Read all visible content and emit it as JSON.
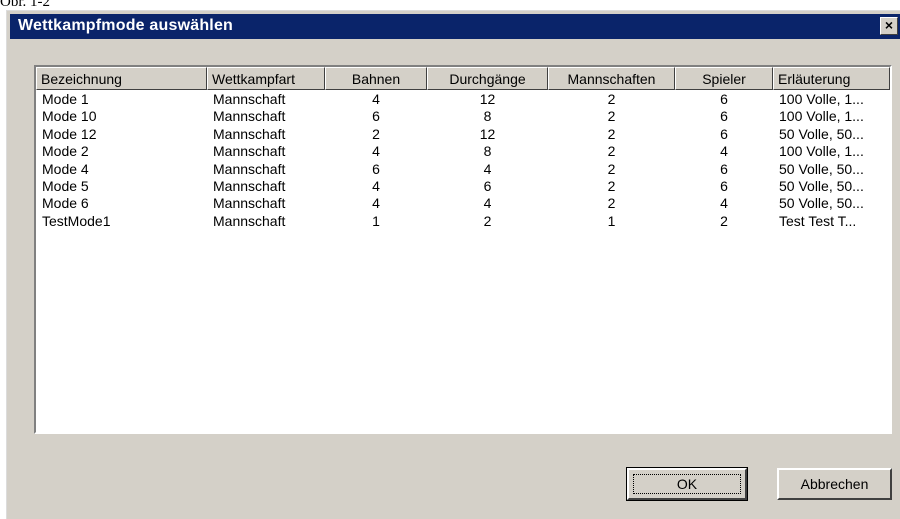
{
  "caption": "Obr. 1-2",
  "window": {
    "title": "Wettkampfmode auswählen",
    "close_label": "×"
  },
  "table": {
    "columns": [
      "Bezeichnung",
      "Wettkampfart",
      "Bahnen",
      "Durchgänge",
      "Mannschaften",
      "Spieler",
      "Erläuterung"
    ],
    "rows": [
      [
        "Mode 1",
        "Mannschaft",
        "4",
        "12",
        "2",
        "6",
        "100 Volle, 1..."
      ],
      [
        "Mode 10",
        "Mannschaft",
        "6",
        "8",
        "2",
        "6",
        "100 Volle, 1..."
      ],
      [
        "Mode 12",
        "Mannschaft",
        "2",
        "12",
        "2",
        "6",
        "50 Volle, 50..."
      ],
      [
        "Mode 2",
        "Mannschaft",
        "4",
        "8",
        "2",
        "4",
        "100 Volle, 1..."
      ],
      [
        "Mode 4",
        "Mannschaft",
        "6",
        "4",
        "2",
        "6",
        "50 Volle, 50..."
      ],
      [
        "Mode 5",
        "Mannschaft",
        "4",
        "6",
        "2",
        "6",
        "50 Volle, 50..."
      ],
      [
        "Mode 6",
        "Mannschaft",
        "4",
        "4",
        "2",
        "4",
        "50 Volle, 50..."
      ],
      [
        "TestMode1",
        "Mannschaft",
        "1",
        "2",
        "1",
        "2",
        "Test Test T..."
      ]
    ]
  },
  "buttons": {
    "ok": "OK",
    "cancel": "Abbrechen"
  }
}
